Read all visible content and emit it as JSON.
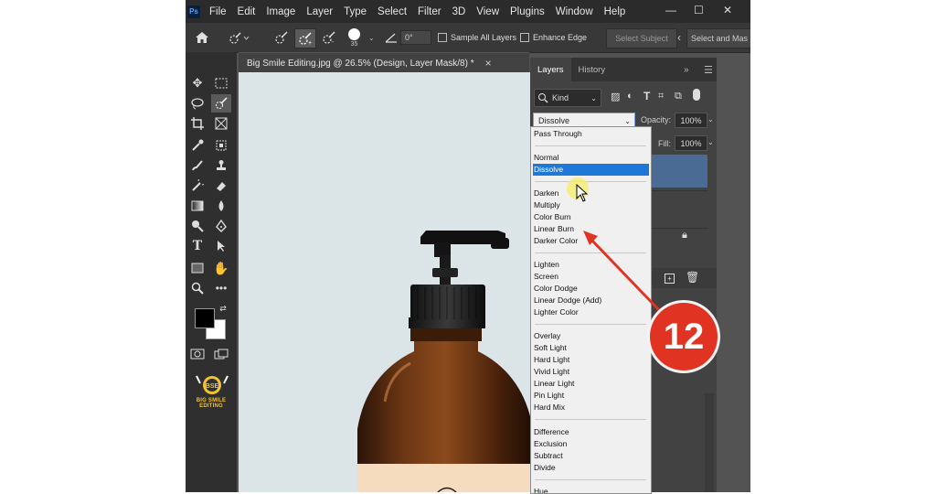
{
  "app": {
    "logo": "Ps",
    "menu": [
      "File",
      "Edit",
      "Image",
      "Layer",
      "Type",
      "Select",
      "Filter",
      "3D",
      "View",
      "Plugins",
      "Window",
      "Help"
    ]
  },
  "options_bar": {
    "brush_size": "35",
    "angle": "0°",
    "sample_all_layers": "Sample All Layers",
    "enhance_edge": "Enhance Edge",
    "select_subject": "Select Subject",
    "select_and_mask": "Select and Mas"
  },
  "document": {
    "tab_title": "Big Smile Editing.jpg @ 26.5% (Design, Layer Mask/8) *",
    "close": "×"
  },
  "brand": {
    "name": "BIG SMILE EDITING",
    "initials": "BSE"
  },
  "layers_panel": {
    "tabs": [
      "Layers",
      "History"
    ],
    "filter_kind": "Kind",
    "blend_mode": "Dissolve",
    "opacity_label": "Opacity:",
    "opacity_value": "100%",
    "fill_label": "Fill:",
    "fill_value": "100%"
  },
  "blend_dropdown": {
    "groups": [
      [
        "Pass Through"
      ],
      [
        "Normal",
        "Dissolve"
      ],
      [
        "Darken",
        "Multiply",
        "Color Burn",
        "Linear Burn",
        "Darker Color"
      ],
      [
        "Lighten",
        "Screen",
        "Color Dodge",
        "Linear Dodge (Add)",
        "Lighter Color"
      ],
      [
        "Overlay",
        "Soft Light",
        "Hard Light",
        "Vivid Light",
        "Linear Light",
        "Pin Light",
        "Hard Mix"
      ],
      [
        "Difference",
        "Exclusion",
        "Subtract",
        "Divide"
      ],
      [
        "Hue"
      ]
    ],
    "selected": "Dissolve"
  },
  "annotation": {
    "step_number": "12",
    "color": "#e03322"
  },
  "colors": {
    "highlight": "#1e78d8",
    "canvas_bg": "#dbe5e8",
    "label_peach": "#f6dcbf"
  }
}
